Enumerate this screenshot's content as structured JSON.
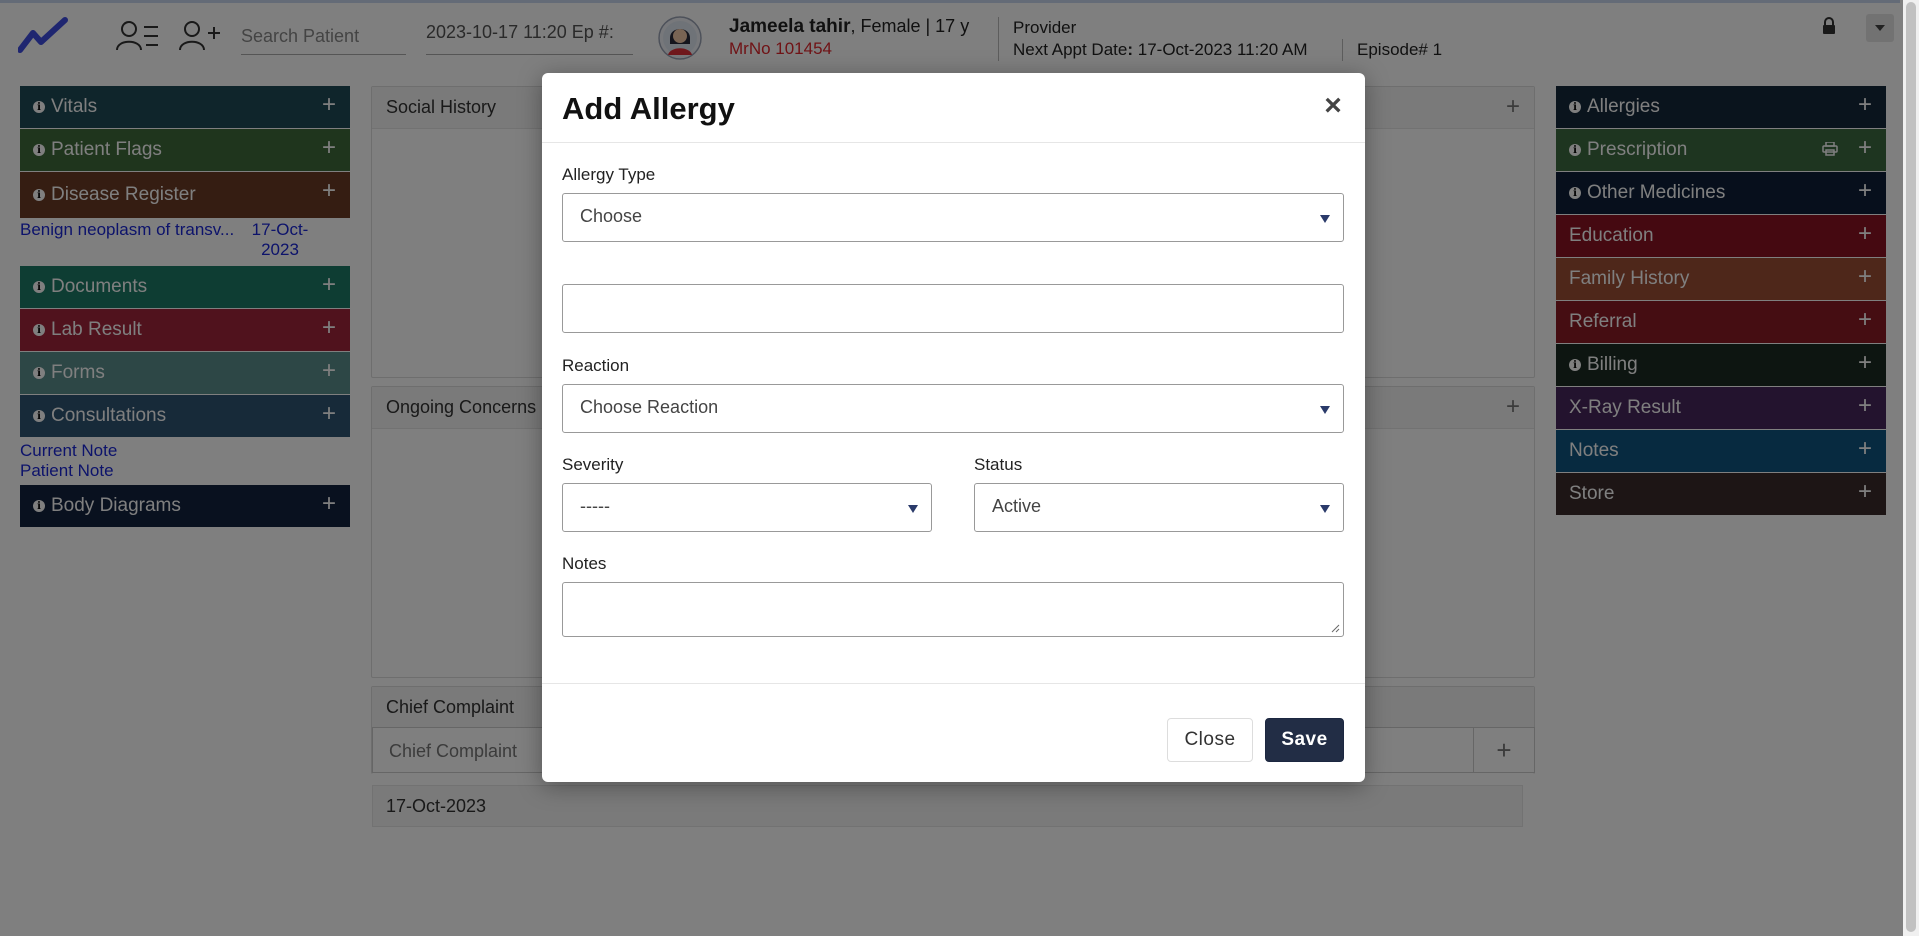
{
  "header": {
    "search_placeholder": "Search Patient",
    "episode_field": "2023-10-17 11:20 Ep #:",
    "patient": {
      "name": "Jameela tahir",
      "demographics": ", Female | 17 y",
      "mrno": "MrNo 101454"
    },
    "provider_label": "Provider",
    "next_appt_label": "Next Appt Date",
    "next_appt_value": "17-Oct-2023 11:20 AM",
    "episode": "Episode# 1"
  },
  "left_panels": [
    {
      "label": "Vitals",
      "color": "#1e4a57"
    },
    {
      "label": "Patient Flags",
      "color": "#3f6b3a"
    },
    {
      "label": "Disease Register",
      "color": "#6b3a24"
    },
    {
      "label": "Documents",
      "color": "#1d7a66"
    },
    {
      "label": "Lab Result",
      "color": "#a1243a"
    },
    {
      "label": "Forms",
      "color": "#5a8e8d"
    },
    {
      "label": "Consultations",
      "color": "#2e5572"
    },
    {
      "label": "Body Diagrams",
      "color": "#13233f"
    }
  ],
  "disease_register_item": {
    "text": "Benign neoplasm of transv...",
    "date": "17-Oct-2023"
  },
  "consultation_links": [
    "Current Note",
    "Patient Note"
  ],
  "right_panels": [
    {
      "label": "Allergies",
      "color": "#15293a"
    },
    {
      "label": "Prescription",
      "color": "#3c6a40"
    },
    {
      "label": "Other Medicines",
      "color": "#0e1f38"
    },
    {
      "label": "Education",
      "color": "#8a1222"
    },
    {
      "label": "Family History",
      "color": "#9c4f35"
    },
    {
      "label": "Referral",
      "color": "#8a1a25"
    },
    {
      "label": "Billing",
      "color": "#1a2b22"
    },
    {
      "label": "X-Ray Result",
      "color": "#47275c"
    },
    {
      "label": "Notes",
      "color": "#0f5581"
    },
    {
      "label": "Store",
      "color": "#3a2a2b"
    }
  ],
  "center": {
    "social_history": "Social History",
    "ongoing_concerns": "Ongoing Concerns",
    "chief_complaint": "Chief Complaint",
    "chief_complaint_placeholder": "Chief Complaint",
    "date": "17-Oct-2023"
  },
  "modal": {
    "title": "Add Allergy",
    "allergy_type_label": "Allergy Type",
    "allergy_type_value": "Choose",
    "allergy_name_value": "",
    "reaction_label": "Reaction",
    "reaction_value": "Choose Reaction",
    "severity_label": "Severity",
    "severity_value": "-----",
    "status_label": "Status",
    "status_value": "Active",
    "notes_label": "Notes",
    "close_label": "Close",
    "save_label": "Save"
  }
}
